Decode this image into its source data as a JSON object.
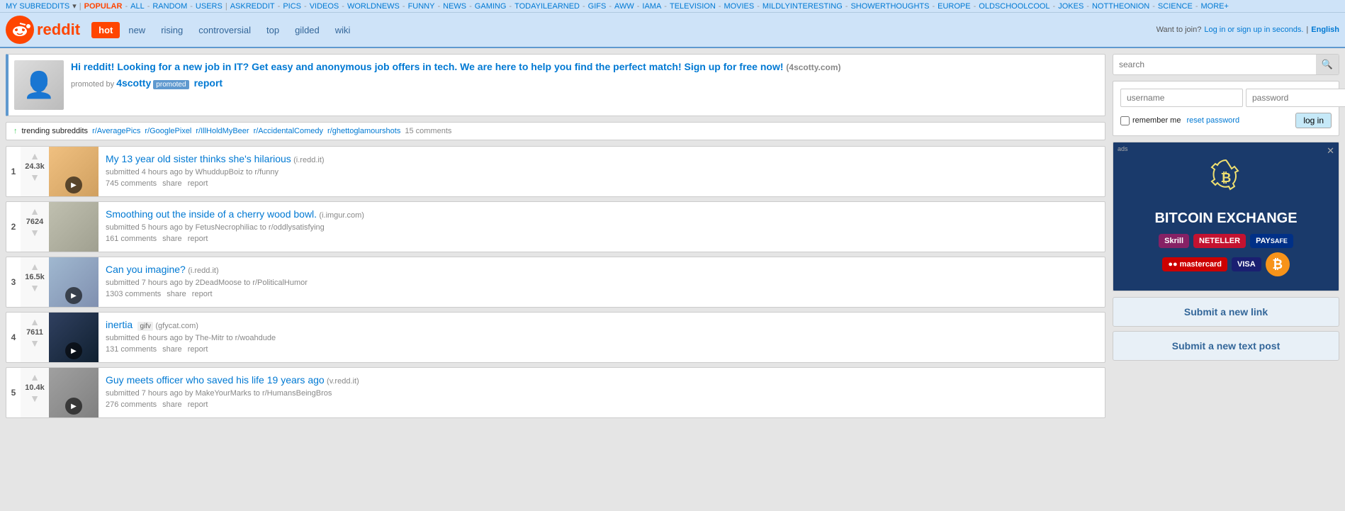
{
  "topnav": {
    "my_subreddits": "MY SUBREDDITS",
    "links": [
      "POPULAR",
      "ALL",
      "RANDOM",
      "USERS",
      "ASKREDDIT",
      "PICS",
      "VIDEOS",
      "WORLDNEWS",
      "FUNNY",
      "NEWS",
      "GAMING",
      "TODAYILEARNED",
      "GIFS",
      "AWW",
      "IAMA",
      "TELEVISION",
      "MOVIES",
      "MILDLYINTERESTING",
      "SHOWERTHOUGHTS",
      "EUROPE",
      "OLDSCHOOLCOOL",
      "JOKES",
      "NOTTHEONION",
      "SCIENCE",
      "MORE+"
    ]
  },
  "header": {
    "logo_text": "reddit",
    "tabs": [
      "hot",
      "new",
      "rising",
      "controversial",
      "top",
      "gilded",
      "wiki"
    ],
    "active_tab": "hot",
    "join_text": "Want to join?",
    "login_link": "Log in or sign up in seconds.",
    "language": "English"
  },
  "promo": {
    "title": "Hi reddit! Looking for a new job in IT? Get easy and anonymous job offers in tech. We are here to help you find the perfect match! Sign up for free now!",
    "domain": "4scotty.com",
    "by": "4scotty",
    "badge": "promoted",
    "report": "report"
  },
  "trending": {
    "label": "trending subreddits",
    "subreddits": [
      "r/AveragePics",
      "r/GooglePixel",
      "r/IllHoldMyBeer",
      "r/AccidentalComedy",
      "r/ghettoglamourshots"
    ],
    "comments": "15 comments"
  },
  "posts": [
    {
      "rank": "1",
      "score": "24.3k",
      "title": "My 13 year old sister thinks she's hilarious",
      "domain": "i.redd.it",
      "time": "4 hours ago",
      "author": "WhuddupBoiz",
      "subreddit": "r/funny",
      "comments": "745 comments",
      "share": "share",
      "report": "report",
      "has_video": true,
      "thumb_class": "thumb-1"
    },
    {
      "rank": "2",
      "score": "7624",
      "title": "Smoothing out the inside of a cherry wood bowl.",
      "domain": "i.imgur.com",
      "time": "5 hours ago",
      "author": "FetusNecrophiliac",
      "subreddit": "r/oddlysatisfying",
      "comments": "161 comments",
      "share": "share",
      "report": "report",
      "has_video": false,
      "thumb_class": "thumb-2"
    },
    {
      "rank": "3",
      "score": "16.5k",
      "title": "Can you imagine?",
      "domain": "i.redd.it",
      "time": "7 hours ago",
      "author": "2DeadMoose",
      "subreddit": "r/PoliticalHumor",
      "comments": "1303 comments",
      "share": "share",
      "report": "report",
      "has_video": true,
      "thumb_class": "thumb-3"
    },
    {
      "rank": "4",
      "score": "7611",
      "title": "inertia",
      "domain": "gfycat.com",
      "gifv": "gifv",
      "time": "6 hours ago",
      "author": "The-Mitr",
      "subreddit": "r/woahdude",
      "comments": "131 comments",
      "share": "share",
      "report": "report",
      "has_video": true,
      "thumb_class": "thumb-4"
    },
    {
      "rank": "5",
      "score": "10.4k",
      "title": "Guy meets officer who saved his life 19 years ago",
      "domain": "v.redd.it",
      "time": "7 hours ago",
      "author": "MakeYourMarks",
      "subreddit": "r/HumansBeingBros",
      "comments": "276 comments",
      "share": "share",
      "report": "report",
      "has_video": true,
      "thumb_class": "thumb-5"
    }
  ],
  "sidebar": {
    "search_placeholder": "search",
    "username_placeholder": "username",
    "password_placeholder": "password",
    "remember_me": "remember me",
    "reset_password": "reset password",
    "login_button": "log in",
    "btc_title": "BITCOIN EXCHANGE",
    "btc_payments": [
      "Skrill",
      "Neteller",
      "PAYSAFE",
      "mastercard",
      "VISA"
    ],
    "submit_link": "Submit a new link",
    "submit_text": "Submit a new text post"
  }
}
